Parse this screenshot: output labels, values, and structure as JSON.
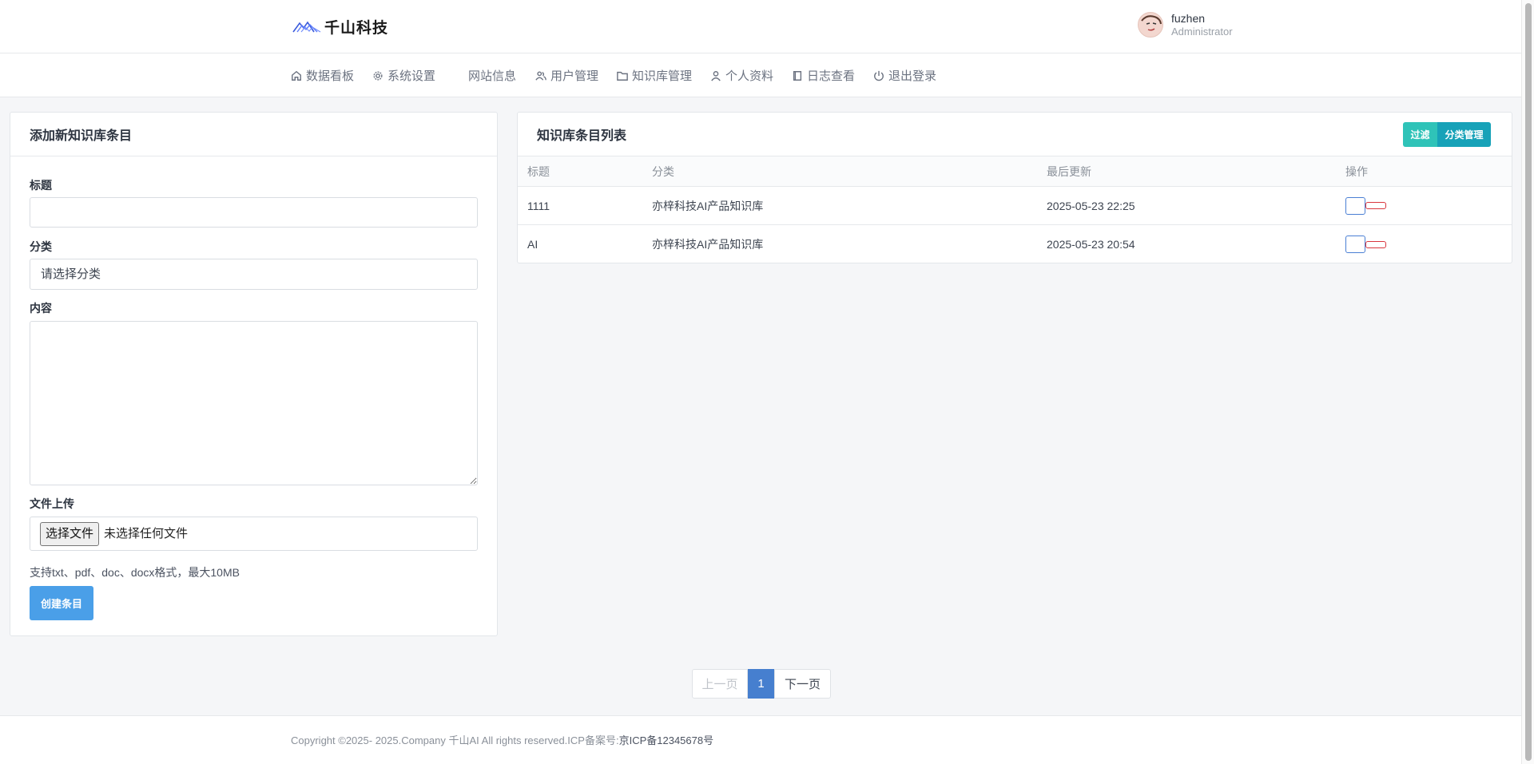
{
  "brand": {
    "logo_text": "千山科技"
  },
  "user": {
    "name": "fuzhen",
    "role": "Administrator"
  },
  "nav": {
    "items": [
      {
        "label": "数据看板",
        "icon": "home-icon"
      },
      {
        "label": "系统设置",
        "icon": "gear-icon"
      },
      {
        "label": "网站信息",
        "icon": ""
      },
      {
        "label": "用户管理",
        "icon": "users-icon"
      },
      {
        "label": "知识库管理",
        "icon": "folder-icon"
      },
      {
        "label": "个人资料",
        "icon": "user-icon"
      },
      {
        "label": "日志查看",
        "icon": "book-icon"
      },
      {
        "label": "退出登录",
        "icon": "power-icon"
      }
    ]
  },
  "form": {
    "title": "添加新知识库条目",
    "title_label": "标题",
    "title_value": "",
    "category_label": "分类",
    "category_value": "请选择分类",
    "content_label": "内容",
    "content_value": "",
    "file_label": "文件上传",
    "file_button": "选择文件",
    "file_status": "未选择任何文件",
    "file_hint": "支持txt、pdf、doc、docx格式，最大10MB",
    "submit": "创建条目"
  },
  "list": {
    "title": "知识库条目列表",
    "filter_button": "过滤",
    "category_button": "分类管理",
    "columns": [
      "标题",
      "分类",
      "最后更新",
      "操作"
    ],
    "rows": [
      {
        "title": "1111",
        "category": "亦梓科技AI产品知识库",
        "updated": "2025-05-23 22:25"
      },
      {
        "title": "AI",
        "category": "亦梓科技AI产品知识库",
        "updated": "2025-05-23 20:54"
      }
    ]
  },
  "pagination": {
    "prev": "上一页",
    "current": "1",
    "next": "下一页"
  },
  "footer": {
    "copyright": "Copyright ©2025- 2025.Company 千山AI All rights reserved.ICP备案号:",
    "icp": "京ICP备12345678号"
  },
  "colors": {
    "primary": "#467fcf",
    "create_button": "#4a9fe8",
    "filter_button": "#2fc3b8",
    "category_button": "#17a2b8",
    "delete_border": "#d9363e"
  }
}
